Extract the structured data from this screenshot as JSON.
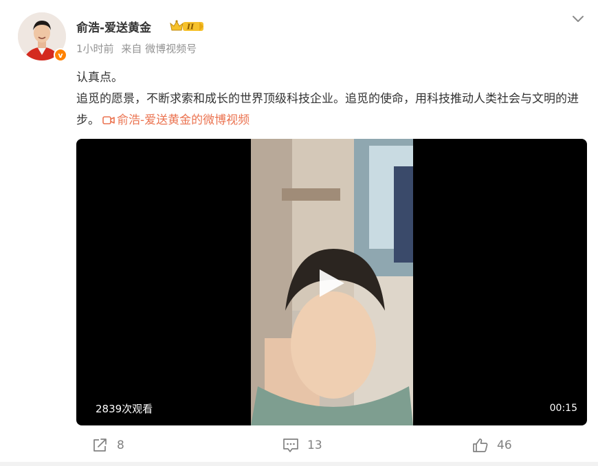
{
  "post": {
    "author": "俞浩-爱送黄金",
    "level_badge": "II",
    "verified_badge": "v",
    "time": "1小时前",
    "source": "来自 微博视频号",
    "text_line1": "认真点。",
    "text_body": "追觅的愿景，不断求索和成长的世界顶级科技企业。追觅的使命，用科技推动人类社会与文明的进步。",
    "video_link_label": "俞浩-爱送黄金的微博视频"
  },
  "video": {
    "views": "2839次观看",
    "duration": "00:15"
  },
  "actions": {
    "repost_count": "8",
    "comment_count": "13",
    "like_count": "46"
  },
  "icons": [
    "avatar",
    "verified-badge-icon",
    "level-crown-icon",
    "chevron-down-icon",
    "video-camera-icon",
    "play-icon",
    "repost-icon",
    "comment-icon",
    "like-icon"
  ],
  "colors": {
    "link": "#eb7350",
    "verified": "#ff8200",
    "meta": "#939393",
    "action": "#808080"
  }
}
